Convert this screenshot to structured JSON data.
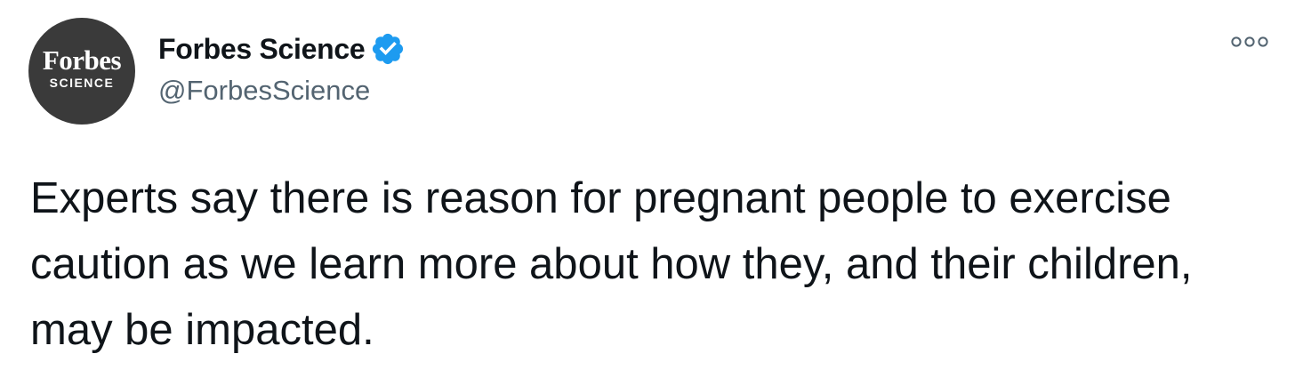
{
  "author": {
    "avatar": {
      "logo_word": "Forbes",
      "logo_sub": "SCIENCE",
      "background_color": "#3a3a3a"
    },
    "display_name": "Forbes Science",
    "verified": true,
    "verified_badge_color": "#1d9bf0",
    "handle": "@ForbesScience"
  },
  "menu": {
    "icon": "more-horizontal-icon"
  },
  "tweet": {
    "text": "Experts say there is reason for pregnant people to exercise caution as we learn more about how they, and their children, may be impacted."
  }
}
